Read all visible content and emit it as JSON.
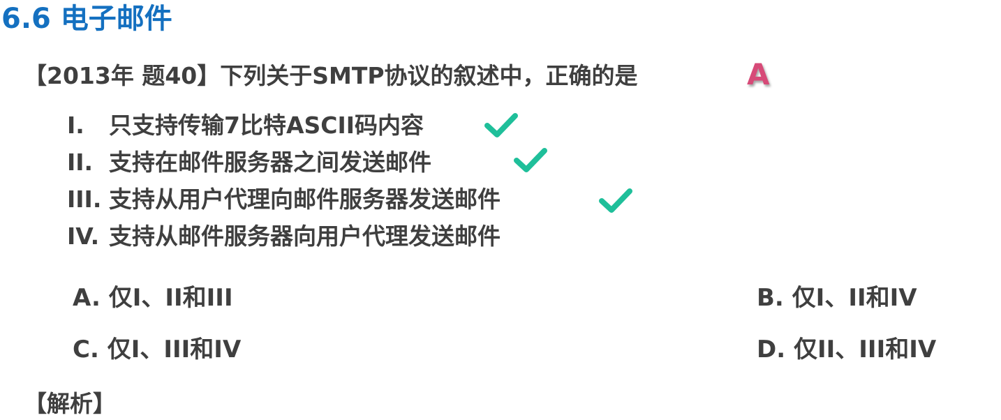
{
  "section_title": "6.6 电子邮件",
  "question": "【2013年 题40】下列关于SMTP协议的叙述中，正确的是",
  "answer_mark": "A",
  "statements": [
    {
      "num": "I.",
      "text": "只支持传输7比特ASCII码内容",
      "checked": true
    },
    {
      "num": "II.",
      "text": "支持在邮件服务器之间发送邮件",
      "checked": true
    },
    {
      "num": "III.",
      "text": "支持从用户代理向邮件服务器发送邮件",
      "checked": true
    },
    {
      "num": "IV.",
      "text": "支持从邮件服务器向用户代理发送邮件",
      "checked": false
    }
  ],
  "options": {
    "a": "A. 仅I、II和III",
    "b": "B. 仅I、II和IV",
    "c": "C. 仅I、III和IV",
    "d": "D. 仅II、III和IV"
  },
  "analysis_label": "【解析】",
  "colors": {
    "title": "#1470c0",
    "text": "#3f3f3f",
    "answer_mark": "#d74a78",
    "check": "#1fbf9a"
  },
  "icons": {
    "check": "checkmark-icon"
  }
}
